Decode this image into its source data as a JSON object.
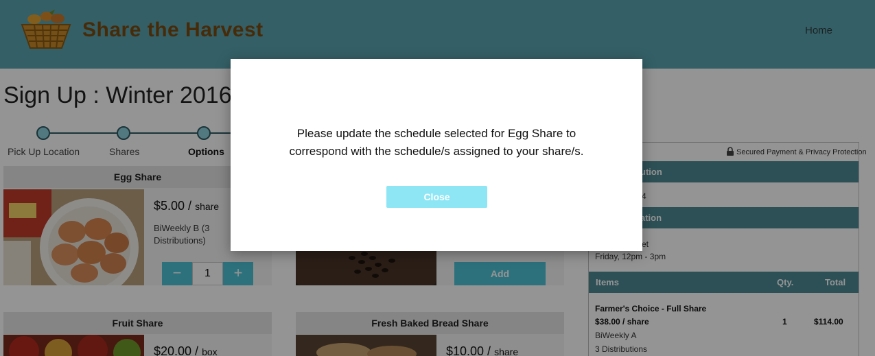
{
  "header": {
    "brand": "Share the Harvest",
    "nav": {
      "home": "Home"
    }
  },
  "page": {
    "title": "Sign Up : Winter 2016"
  },
  "steps": [
    {
      "label": "Pick Up Location"
    },
    {
      "label": "Shares"
    },
    {
      "label": "Options"
    }
  ],
  "cards": {
    "egg": {
      "title": "Egg Share",
      "price": "$5.00 /",
      "unit": "share",
      "schedule_line1": "BiWeekly B (3",
      "schedule_line2": "Distributions)",
      "quantity": "1",
      "minus": "−",
      "plus": "+"
    },
    "second": {
      "add_label": "Add"
    },
    "fruit": {
      "title": "Fruit Share",
      "price": "$20.00 /",
      "unit": "box"
    },
    "bread": {
      "title": "Fresh Baked Bread Share",
      "price": "$10.00 /",
      "unit": "share"
    }
  },
  "summary": {
    "secure_label": "Secured Payment & Privacy Protection",
    "bar1_fragment": "ution",
    "row1_fragment": "4",
    "bar2_fragment": "ation",
    "row2_fragment": "et",
    "pickup_time": "Friday, 12pm - 3pm",
    "columns": {
      "items": "Items",
      "qty": "Qty.",
      "total": "Total"
    },
    "item": {
      "name": "Farmer's Choice - Full Share",
      "price": "$38.00 / share",
      "qty": "1",
      "total": "$114.00",
      "schedule": "BiWeekly A",
      "distributions": "3 Distributions"
    }
  },
  "modal": {
    "message_line1": "Please update the schedule selected for Egg Share to",
    "message_line2": "correspond with the schedule/s assigned to your share/s.",
    "close_label": "Close"
  },
  "colors": {
    "header_bg": "#5aa4b0",
    "brand_text": "#7a4a10",
    "accent": "#4fc3d8",
    "summary_bar": "#4e8a95",
    "close_button": "#8ee6f5"
  }
}
